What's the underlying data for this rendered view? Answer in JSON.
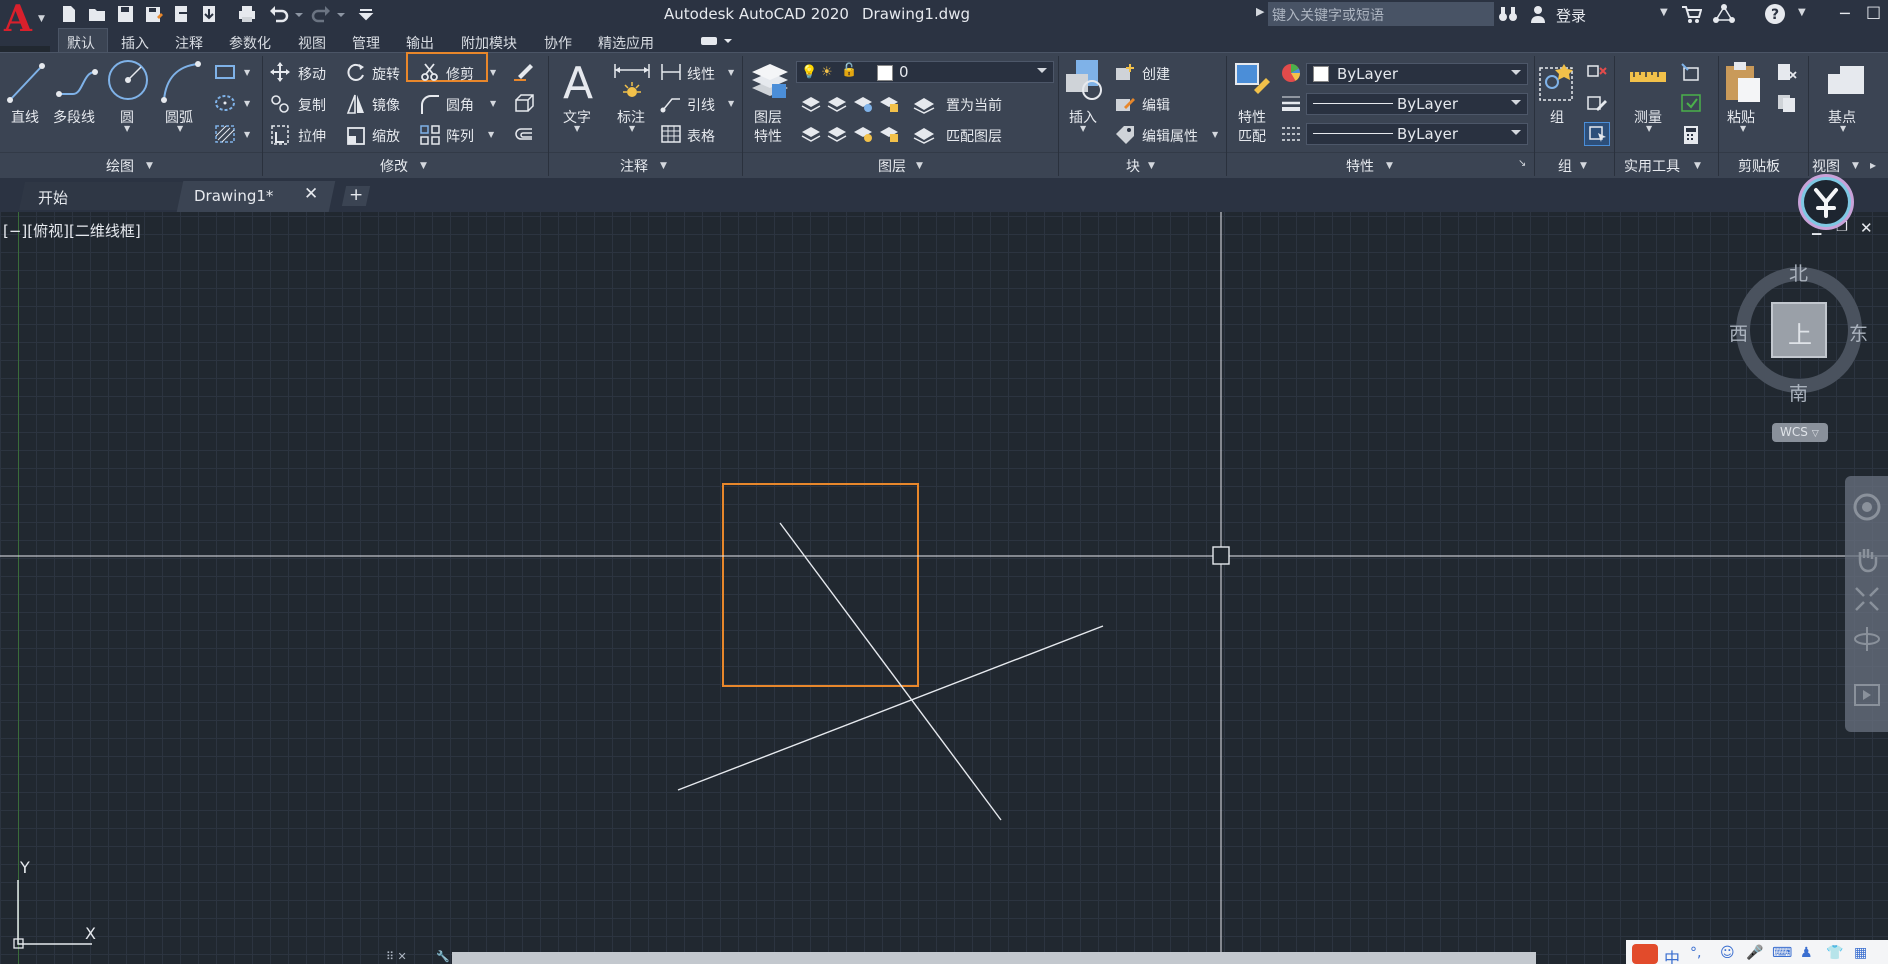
{
  "app": {
    "logo_letter": "A",
    "title": "Autodesk AutoCAD 2020",
    "filename": "Drawing1.dwg",
    "search_placeholder": "键入关键字或短语",
    "signin": "登录"
  },
  "ribbon_tabs": [
    "默认",
    "插入",
    "注释",
    "参数化",
    "视图",
    "管理",
    "输出",
    "附加模块",
    "协作",
    "精选应用"
  ],
  "panels": {
    "draw": {
      "label": "绘图",
      "line": "直线",
      "polyline": "多段线",
      "circle": "圆",
      "arc": "圆弧"
    },
    "modify": {
      "label": "修改",
      "move": "移动",
      "rotate": "旋转",
      "trim": "修剪",
      "copy": "复制",
      "mirror": "镜像",
      "fillet": "圆角",
      "stretch": "拉伸",
      "scale": "缩放",
      "array": "阵列"
    },
    "annotation": {
      "label": "注释",
      "text": "文字",
      "dimension": "标注",
      "linear": "线性",
      "leader": "引线",
      "table": "表格"
    },
    "layers": {
      "label": "图层",
      "properties_line1": "图层",
      "properties_line2": "特性",
      "current_layer": "0",
      "make_current": "置为当前",
      "match_layer": "匹配图层"
    },
    "block": {
      "label": "块",
      "insert": "插入",
      "create": "创建",
      "edit": "编辑",
      "edit_attributes": "编辑属性"
    },
    "properties": {
      "label": "特性",
      "match_line1": "特性",
      "match_line2": "匹配",
      "color": "ByLayer",
      "linetype": "ByLayer",
      "lineweight": "ByLayer"
    },
    "groups": {
      "label": "组",
      "group": "组"
    },
    "utilities": {
      "label": "实用工具",
      "measure": "测量"
    },
    "clipboard": {
      "label": "剪贴板",
      "paste": "粘贴"
    },
    "view": {
      "label": "视图",
      "base": "基点"
    }
  },
  "file_tabs": [
    "开始",
    "Drawing1*"
  ],
  "viewport": {
    "label": "[−][俯视][二维线框]",
    "viewcube": {
      "north": "北",
      "south": "南",
      "east": "东",
      "west": "西",
      "top": "上",
      "wcs": "WCS"
    },
    "ucs": {
      "y": "Y",
      "x": "X"
    }
  },
  "colors": {
    "accent_highlight": "#e8872b",
    "title_red": "#d8202c",
    "background": "#212830"
  },
  "ime": {
    "label": "中"
  }
}
